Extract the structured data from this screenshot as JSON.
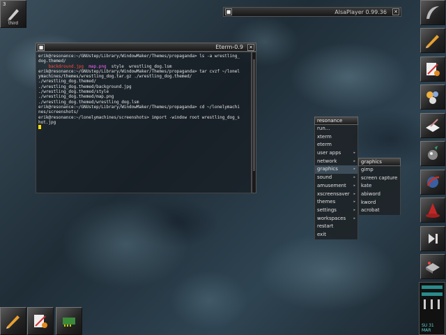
{
  "miniwindow": {
    "number": "3",
    "title": "third",
    "icon": "pencil-icon"
  },
  "alsaplayer": {
    "title": "AlsaPlayer 0.99.36",
    "left_button": "■",
    "close_button": "✕"
  },
  "eterm": {
    "title": "Eterm-0.9",
    "left_button": "■",
    "close_button": "✕",
    "lines": [
      "erik@resonance:~/GNUstep/Library/WindowMaker/Themes/propaganda> ls -a wrestling_",
      "dog.themed/",
      "    backdround.jpg  map.png  style  wrestling_dog.lsm",
      "erik@resonance:~/GNUstep/Library/WindowMaker/Themes/propaganda> tar cvzf ~/lonel",
      "ymachines/themes/wrestling_dog.tar.gz ./wrestling_dog.themed/",
      "./wrestling_dog.themed/",
      "./wrestling_dog.themed/background.jpg",
      "./wrestling_dog.themed/style",
      "./wrestling_dog.themed/map.png",
      "./wrestling_dog.themed/wrestling_dog.lsm",
      "erik@resonance:~/GNUstep/Library/WindowMaker/Themes/propaganda> cd ~/lonelymachi",
      "nes/screenshots/",
      "erik@resonance:~/lonelymachines/screenshots> import -window root wrestling_dog_s",
      "hot.jpg"
    ],
    "ls_items": {
      "red": "backdround.jpg",
      "magenta": "map.png",
      "plain": "style  wrestling_dog.lsm"
    }
  },
  "root_menu": {
    "title": "resonance",
    "items": [
      {
        "label": "run...",
        "submenu": false
      },
      {
        "label": "xterm",
        "submenu": false
      },
      {
        "label": "eterm",
        "submenu": false
      },
      {
        "label": "user apps",
        "submenu": true
      },
      {
        "label": "network",
        "submenu": true
      },
      {
        "label": "graphics",
        "submenu": true,
        "selected": true
      },
      {
        "label": "sound",
        "submenu": true
      },
      {
        "label": "amusement",
        "submenu": true
      },
      {
        "label": "xscreensaver",
        "submenu": true
      },
      {
        "label": "themes",
        "submenu": true
      },
      {
        "label": "settings",
        "submenu": true
      },
      {
        "label": "workspaces",
        "submenu": true
      },
      {
        "label": "restart",
        "submenu": false
      },
      {
        "label": "exit",
        "submenu": false
      }
    ]
  },
  "graphics_menu": {
    "title": "graphics",
    "items": [
      "gimp",
      "screen capture",
      "kate",
      "abiword",
      "kword",
      "acrobat"
    ]
  },
  "dock": {
    "icons": [
      "windowmaker-icon",
      "pencil-icon",
      "office-icon",
      "bubbles-icon",
      "writer-icon",
      "gimp-icon",
      "browser-icon",
      "wizard-hat-icon",
      "media-next-icon",
      "harddrive-icon",
      "mixer-icon"
    ],
    "clock_month": "SU 31 MAR"
  },
  "clip": {
    "icons": [
      "pencil-icon",
      "office-icon",
      "network-card-icon"
    ]
  }
}
